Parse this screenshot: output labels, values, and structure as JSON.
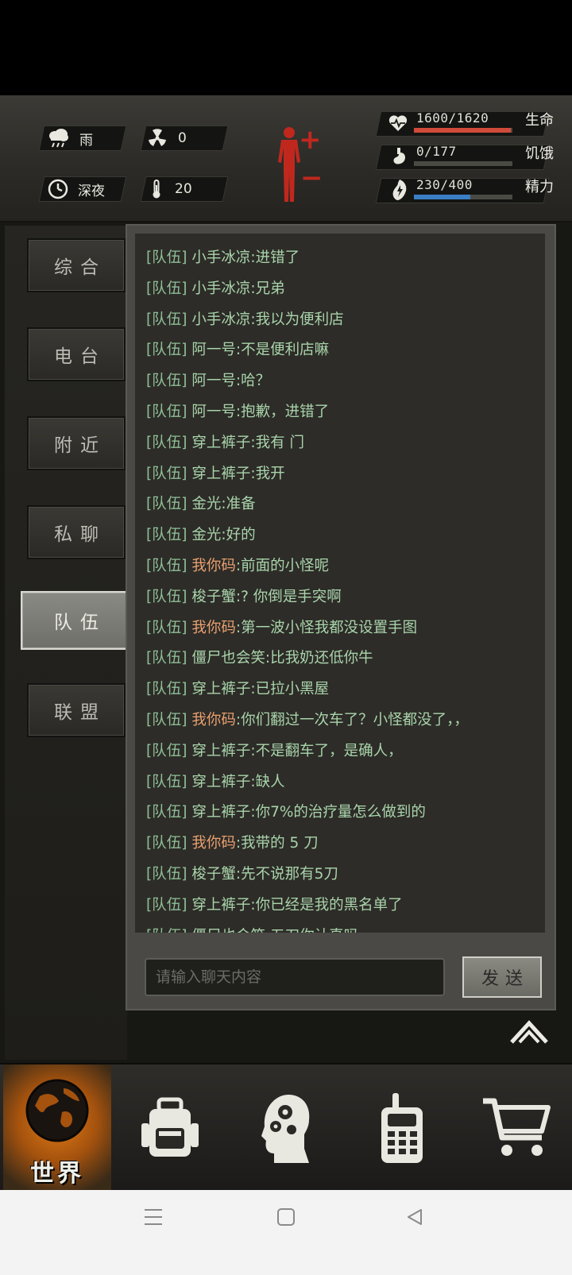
{
  "status": {
    "weather": {
      "icon": "rain-cloud-icon",
      "label": "雨"
    },
    "radiation": {
      "icon": "radiation-icon",
      "value": "0"
    },
    "time_of_day": {
      "icon": "clock-icon",
      "label": "深夜"
    },
    "temperature": {
      "icon": "thermometer-icon",
      "value": "20"
    },
    "body": {
      "icon": "body-silhouette-icon",
      "plus": "+",
      "minus": "−"
    },
    "health": {
      "icon": "heart-pulse-icon",
      "text": "1600/1620",
      "label": "生命",
      "current": 1600,
      "max": 1620,
      "color": "#d04a3a"
    },
    "hunger": {
      "icon": "stomach-icon",
      "text": "0/177",
      "label": "饥饿",
      "current": 0,
      "max": 177,
      "color": "#8a8a84"
    },
    "energy": {
      "icon": "energy-icon",
      "text": "230/400",
      "label": "精力",
      "current": 230,
      "max": 400,
      "color": "#3a7fc4"
    }
  },
  "tabs": [
    {
      "label": "综合",
      "active": false
    },
    {
      "label": "电台",
      "active": false
    },
    {
      "label": "附近",
      "active": false
    },
    {
      "label": "私聊",
      "active": false
    },
    {
      "label": "队伍",
      "active": true
    },
    {
      "label": "联盟",
      "active": false
    }
  ],
  "chat": {
    "messages": [
      {
        "channel": "[队伍]",
        "name": "小手冰凉",
        "text": ":进错了",
        "self": false
      },
      {
        "channel": "[队伍]",
        "name": "小手冰凉",
        "text": ":兄弟",
        "self": false
      },
      {
        "channel": "[队伍]",
        "name": "小手冰凉",
        "text": ":我以为便利店",
        "self": false
      },
      {
        "channel": "[队伍]",
        "name": "阿一号",
        "text": ":不是便利店嘛",
        "self": false
      },
      {
        "channel": "[队伍]",
        "name": "阿一号",
        "text": ":哈？",
        "self": false
      },
      {
        "channel": "[队伍]",
        "name": "阿一号",
        "text": ":抱歉，进错了",
        "self": false
      },
      {
        "channel": "[队伍]",
        "name": "穿上裤子",
        "text": ":我有       门",
        "self": false
      },
      {
        "channel": "[队伍]",
        "name": "穿上裤子",
        "text": ":我开",
        "self": false
      },
      {
        "channel": "[队伍]",
        "name": "金光",
        "text": ":准备",
        "self": false
      },
      {
        "channel": "[队伍]",
        "name": "金光",
        "text": ":好的",
        "self": false
      },
      {
        "channel": "[队伍]",
        "name": "我你码",
        "text": ":前面的小怪呢",
        "self": true
      },
      {
        "channel": "[队伍]",
        "name": "梭子蟹",
        "text": ":? 你倒是手突啊",
        "self": false
      },
      {
        "channel": "[队伍]",
        "name": "我你码",
        "text": ":第一波小怪我都没设置手图",
        "self": true
      },
      {
        "channel": "[队伍]",
        "name": "僵尸也会笑",
        "text": ":比我奶还低你牛",
        "self": false
      },
      {
        "channel": "[队伍]",
        "name": "穿上裤子",
        "text": ":已拉小黑屋",
        "self": false
      },
      {
        "channel": "[队伍]",
        "name": "我你码",
        "text": ":你们翻过一次车了？小怪都没了，，",
        "self": true
      },
      {
        "channel": "[队伍]",
        "name": "穿上裤子",
        "text": ":不是翻车了，是确人，",
        "self": false
      },
      {
        "channel": "[队伍]",
        "name": "穿上裤子",
        "text": ":缺人",
        "self": false
      },
      {
        "channel": "[队伍]",
        "name": "穿上裤子",
        "text": ":你7%的治疗量怎么做到的",
        "self": false
      },
      {
        "channel": "[队伍]",
        "name": "我你码",
        "text": ":我带的 5 刀",
        "self": true
      },
      {
        "channel": "[队伍]",
        "name": "梭子蟹",
        "text": ":先不说那有5刀",
        "self": false
      },
      {
        "channel": "[队伍]",
        "name": "穿上裤子",
        "text": ":你已经是我的黑名单了",
        "self": false
      },
      {
        "channel": "[队伍]",
        "name": "僵尸也会笑",
        "text": ":五刀你认真吗",
        "self": false
      }
    ],
    "input_placeholder": "请输入聊天内容",
    "send_label": "发送"
  },
  "bottom_nav": [
    {
      "icon": "globe-icon",
      "label": "世界",
      "active": true
    },
    {
      "icon": "backpack-icon"
    },
    {
      "icon": "head-gears-icon"
    },
    {
      "icon": "walkie-talkie-icon"
    },
    {
      "icon": "shopping-cart-icon"
    }
  ],
  "system_nav": [
    "menu-icon",
    "home-icon",
    "back-icon"
  ]
}
